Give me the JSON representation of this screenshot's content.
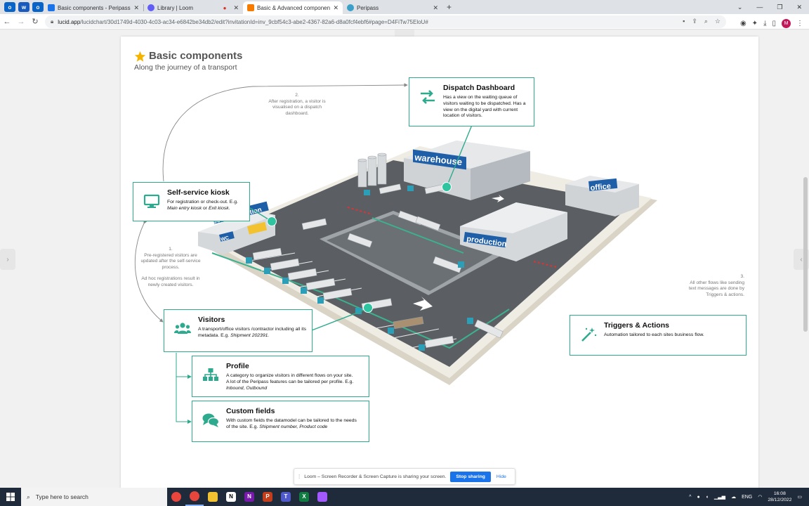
{
  "browser": {
    "tabs": [
      {
        "label": "Basic components - Peripass",
        "color": "#1a73e8",
        "active": false
      },
      {
        "label": "Library | Loom",
        "color": "#625df5",
        "active": false,
        "recording": true
      },
      {
        "label": "Basic & Advanced components",
        "color": "#f57c00",
        "active": true
      },
      {
        "label": "Peripass",
        "color": "#3aa0c8",
        "active": false
      }
    ],
    "url_host": "lucid.app",
    "url_path": "/lucidchart/30d1749d-4030-4c03-ac34-e6842be34db2/edit?invitationId=inv_9cbf54c3-abe2-4367-82a6-d8a0fcf4ebf6#page=D4FiTw75EloU#",
    "avatar_initial": "M"
  },
  "diagram": {
    "title": "Basic components",
    "subtitle": "Along the journey of a transport",
    "boxes": {
      "dispatch": {
        "title": "Dispatch Dashboard",
        "desc": "Has a view on the waiting queue of visitors waiting to be dispatched. Has a view on the digital yard with current location of visitors."
      },
      "kiosk": {
        "title": "Self-service kiosk",
        "desc_pre": "For registration or check-out. E.g. ",
        "desc_em": "Main entry kiosk",
        "desc_mid": " or ",
        "desc_em2": "Exit kiosk."
      },
      "visitors": {
        "title": "Visitors",
        "desc_pre": "A transport/office visitors /contractor including all its metadata. E.g. ",
        "desc_em": "Shipment 202391."
      },
      "profile": {
        "title": "Profile",
        "desc_pre": "A category to organize visitors in different flows on your site. A lot of the Peripass features can be tailored per profile.  E.g. ",
        "desc_em": "Inbound, Outbound"
      },
      "custom": {
        "title": "Custom fields",
        "desc_pre": "With custom fields the datamodel can be tailored to the needs of the site. E.g. ",
        "desc_em": "Shipment number, Product code"
      },
      "triggers": {
        "title": "Triggers & Actions",
        "desc": "Automation tailored to each sites business flow."
      }
    },
    "notes": {
      "n2_num": "2.",
      "n2": "After registration, a visitor is visualised on a dispatch dashboard.",
      "n1_num": "1.",
      "n1": "Pre-registered visitors are updated after the self-service process.",
      "n1b": "Ad hoc registrations result in newly created visitors.",
      "n3_num": "3.",
      "n3": "All other flows like sending text messages are done by Triggers & actions."
    },
    "labels": {
      "warehouse": "warehouse",
      "office": "office",
      "production": "production",
      "self_registration": "self registration",
      "wc": "WC"
    },
    "accent": "#2eaa8e"
  },
  "loom": {
    "message": "Loom – Screen Recorder & Screen Capture is sharing your screen.",
    "stop_label": "Stop sharing",
    "hide_label": "Hide"
  },
  "taskbar": {
    "search_placeholder": "Type here to search",
    "lang": "ENG",
    "time": "16:08",
    "date": "28/12/2022"
  }
}
